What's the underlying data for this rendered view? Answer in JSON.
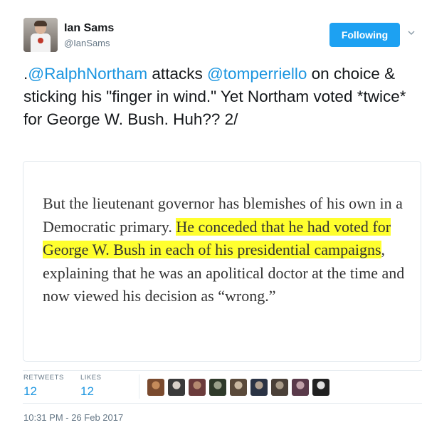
{
  "author": {
    "name": "Ian Sams",
    "handle": "@IanSams"
  },
  "follow_button": {
    "label": "Following",
    "color": "#1da1f2"
  },
  "tweet": {
    "prefix": ".",
    "mention1": "@RalphNortham",
    "text1": " attacks ",
    "mention2": "@tomperriello",
    "text2": " on choice & sticking his \"finger in wind.\" Yet Northam voted *twice* for George W. Bush. Huh?? 2/",
    "mention_color": "#1b95e0"
  },
  "image": {
    "text_before": "But the lieutenant governor has blemishes of his own in a Democratic primary. ",
    "highlighted": "He conceded that he had voted for George W. Bush in each of his presidential campaigns",
    "text_after": ", explaining that he was an apolitical doctor at the time and now viewed his decision as “wrong.”",
    "highlight_color": "#ffff2e"
  },
  "stats": {
    "retweets_label": "RETWEETS",
    "retweets_value": "12",
    "likes_label": "LIKES",
    "likes_value": "12"
  },
  "likers": [
    {
      "icon": "liker-avatar-1"
    },
    {
      "icon": "liker-avatar-2"
    },
    {
      "icon": "liker-avatar-3"
    },
    {
      "icon": "liker-avatar-4"
    },
    {
      "icon": "liker-avatar-5"
    },
    {
      "icon": "liker-avatar-6"
    },
    {
      "icon": "liker-avatar-7"
    },
    {
      "icon": "liker-avatar-8"
    },
    {
      "icon": "liker-avatar-9"
    }
  ],
  "timestamp": "10:31 PM - 26 Feb 2017"
}
